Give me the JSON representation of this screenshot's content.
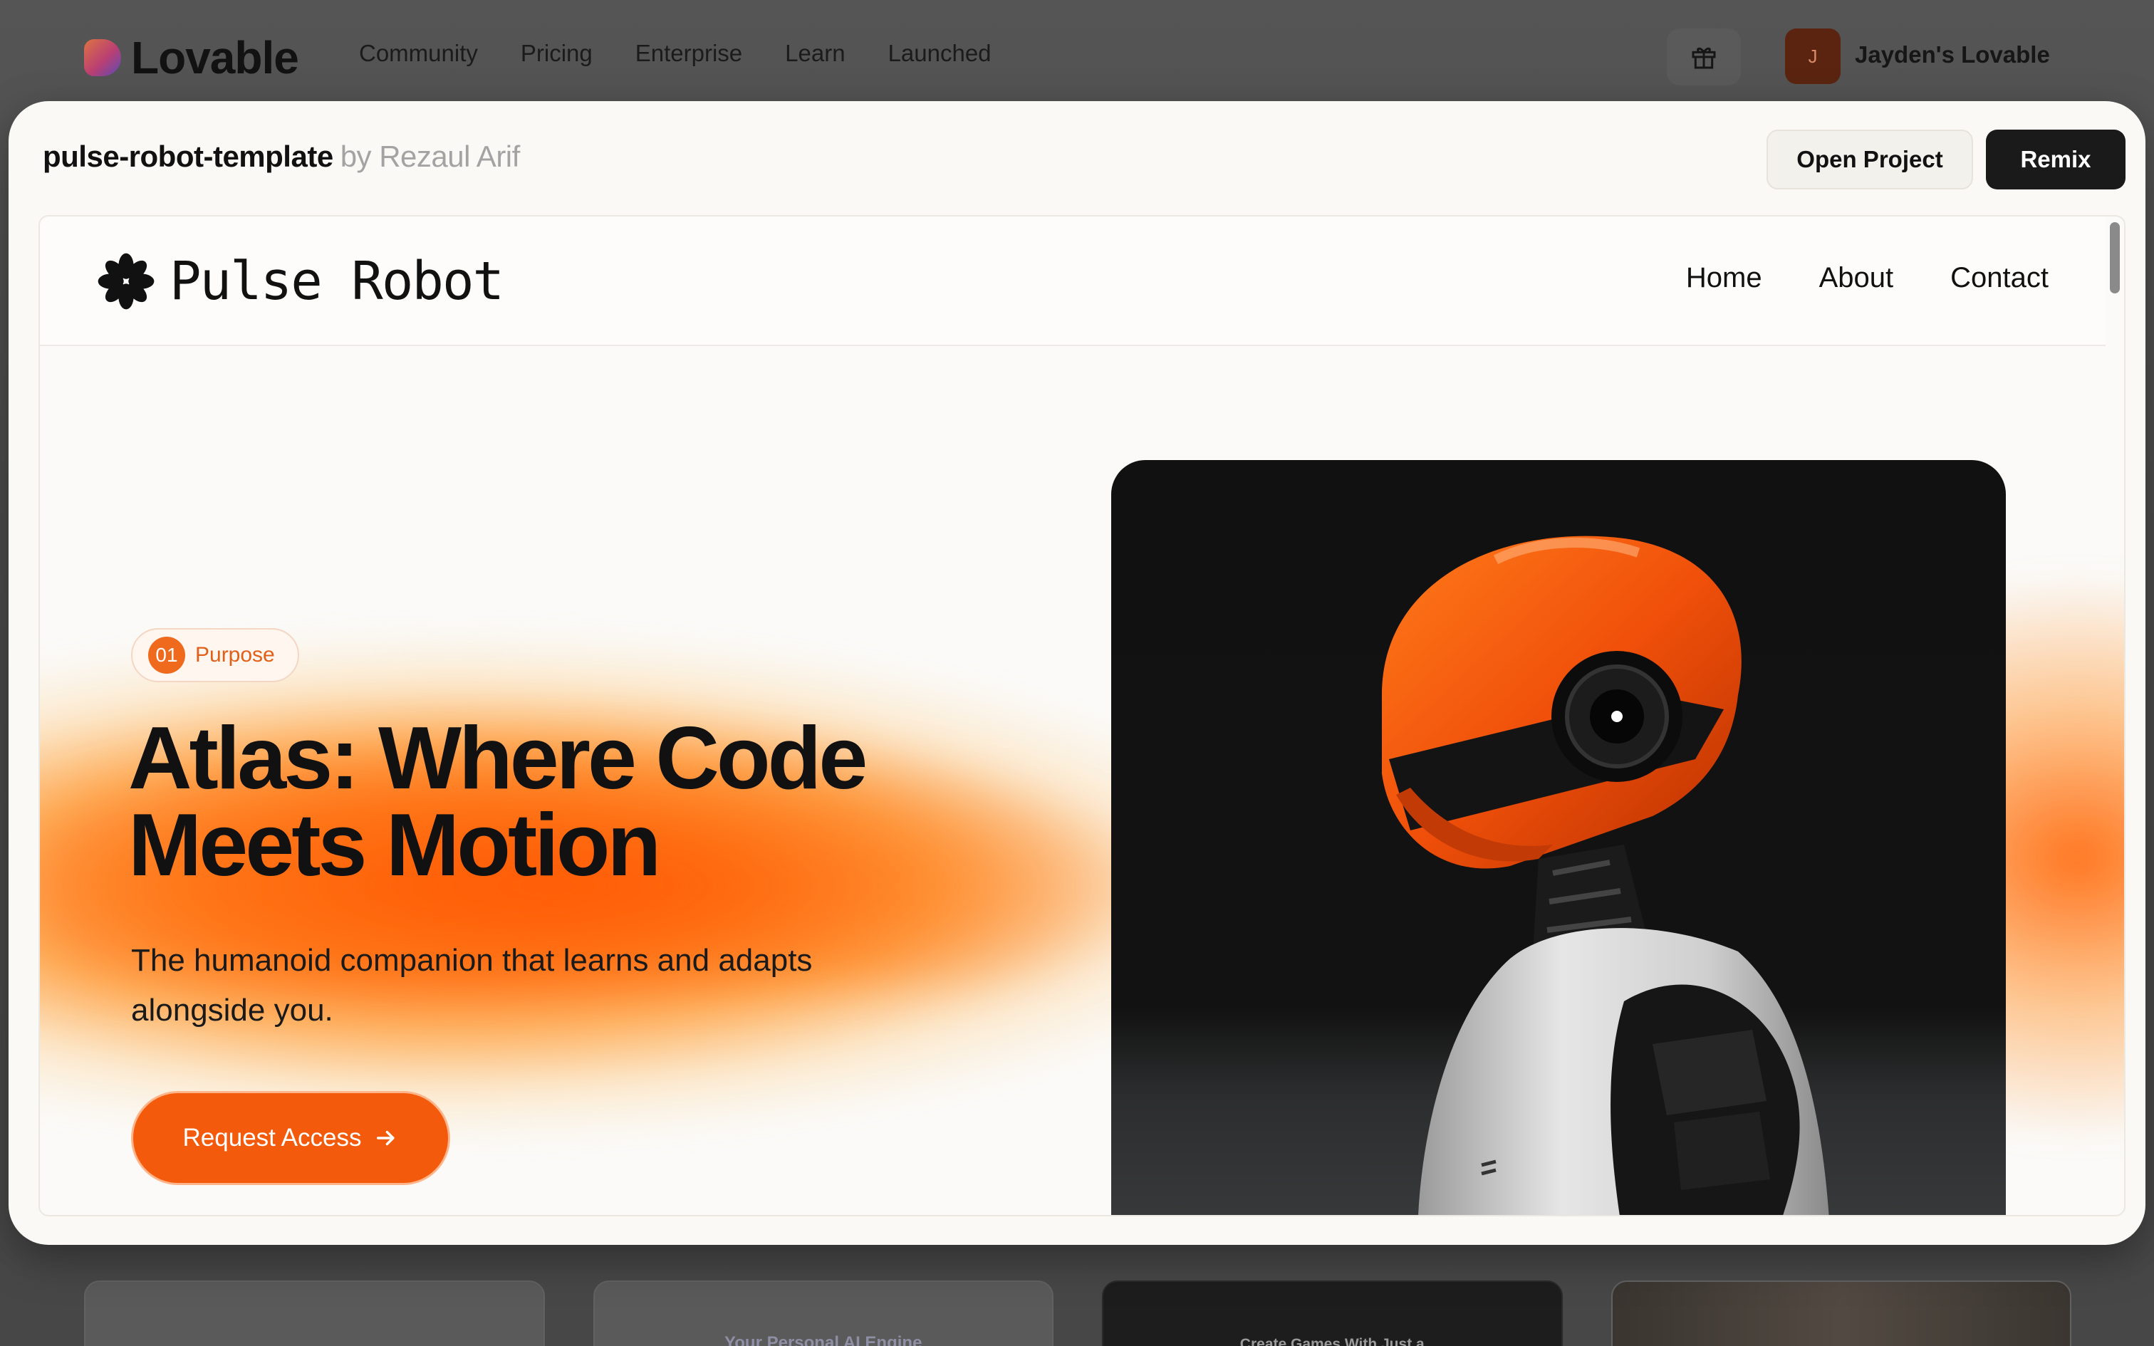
{
  "background": {
    "brand": "Lovable",
    "nav": [
      "Community",
      "Pricing",
      "Enterprise",
      "Learn",
      "Launched"
    ],
    "avatar_initial": "J",
    "workspace_name": "Jayden's Lovable",
    "cards": [
      {
        "label": ""
      },
      {
        "label": "Your Personal AI Engine"
      },
      {
        "label": "Create Games With Just a"
      },
      {
        "label": ""
      }
    ]
  },
  "modal": {
    "project_name": "pulse-robot-template",
    "author": "by Rezaul Arif",
    "open_label": "Open Project",
    "remix_label": "Remix"
  },
  "site": {
    "logo_text": "Pulse Robot",
    "nav": [
      "Home",
      "About",
      "Contact"
    ],
    "badge_number": "01",
    "badge_label": "Purpose",
    "hero_title": "Atlas: Where Code Meets Motion",
    "hero_subtitle": "The humanoid companion that learns and adapts alongside you.",
    "cta_label": "Request Access"
  },
  "colors": {
    "accent": "#f45a0b",
    "dark_button": "#1a1a1a",
    "modal_bg": "#faf9f6"
  },
  "icons": {
    "gift": "gift-icon",
    "logo": "asterisk-flower-icon",
    "cta": "arrow-right-icon"
  }
}
